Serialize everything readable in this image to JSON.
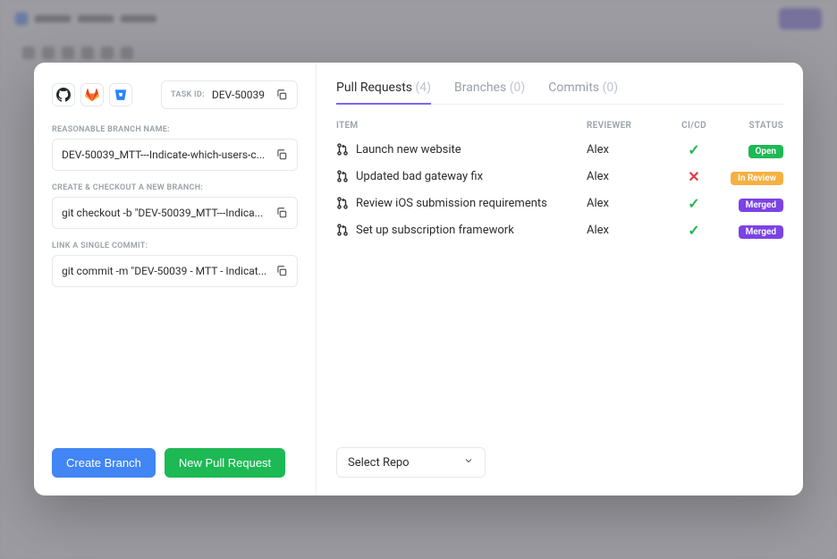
{
  "task": {
    "id_label": "TASK ID:",
    "id_value": "DEV-50039"
  },
  "fields": {
    "branch_name_label": "REASONABLE BRANCH NAME:",
    "branch_name_value": "DEV-50039_MTT---Indicate-which-users-c...",
    "checkout_label": "CREATE & CHECKOUT A NEW BRANCH:",
    "checkout_value": "git checkout -b \"DEV-50039_MTT---Indica...",
    "commit_label": "LINK A SINGLE COMMIT:",
    "commit_value": "git commit -m \"DEV-50039 - MTT - Indicat..."
  },
  "buttons": {
    "create_branch": "Create Branch",
    "new_pr": "New Pull Request"
  },
  "tabs": [
    {
      "label": "Pull Requests",
      "count": "(4)",
      "active": true
    },
    {
      "label": "Branches",
      "count": "(0)",
      "active": false
    },
    {
      "label": "Commits",
      "count": "(0)",
      "active": false
    }
  ],
  "columns": {
    "item": "ITEM",
    "reviewer": "REVIEWER",
    "cicd": "CI/CD",
    "status": "STATUS"
  },
  "pull_requests": [
    {
      "title": "Launch new website",
      "reviewer": "Alex",
      "cicd": "pass",
      "status": "Open",
      "status_class": "badge-open"
    },
    {
      "title": "Updated bad gateway fix",
      "reviewer": "Alex",
      "cicd": "fail",
      "status": "In Review",
      "status_class": "badge-review"
    },
    {
      "title": "Review iOS submission requirements",
      "reviewer": "Alex",
      "cicd": "pass",
      "status": "Merged",
      "status_class": "badge-merged"
    },
    {
      "title": "Set up subscription framework",
      "reviewer": "Alex",
      "cicd": "pass",
      "status": "Merged",
      "status_class": "badge-merged"
    }
  ],
  "select_repo": "Select Repo",
  "icons": {
    "github": "github-icon",
    "gitlab": "gitlab-icon",
    "bitbucket": "bitbucket-icon"
  },
  "colors": {
    "accent": "#7b68ee",
    "primary_blue": "#4285f4",
    "success": "#1db954",
    "warning": "#f5b041",
    "danger": "#e63946",
    "purple_badge": "#7b42e6"
  }
}
